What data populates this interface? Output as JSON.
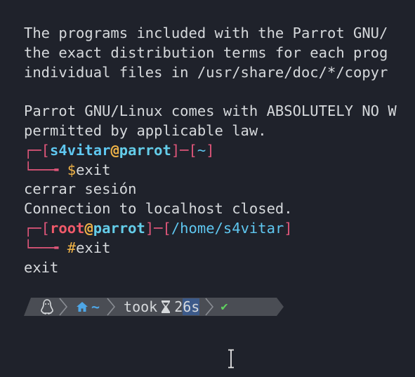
{
  "terminal": {
    "lines": {
      "l1": "The programs included with the Parrot GNU/",
      "l2": "the exact distribution terms for each prog",
      "l3": "individual files in /usr/share/doc/*/copyr",
      "l5": "Parrot GNU/Linux comes with ABSOLUTELY NO W",
      "l6": "permitted by applicable law.",
      "logout_msg": "cerrar sesión",
      "conn_closed": "Connection to localhost closed.",
      "exit_out": "exit"
    },
    "prompt1": {
      "user": "s4vitar",
      "at": "@",
      "host": "parrot",
      "path": "~",
      "symbol": "$",
      "command": "exit"
    },
    "prompt2": {
      "user": "root",
      "at": "@",
      "host": "parrot",
      "path": "/home/s4vitar",
      "symbol": "#",
      "command": "exit"
    },
    "statusbar": {
      "os_icon": "tux-icon",
      "dir_icon": "home-icon",
      "dir": "~",
      "took_label": "took",
      "timer_icon": "hourglass-icon",
      "duration_a": "2",
      "duration_b": "6s",
      "status_icon": "✔"
    },
    "colors": {
      "background": "#1f222b",
      "text": "#d6d9dc",
      "prompt_box": "#e0567a",
      "user_blue": "#5fc7f0",
      "user_red": "#f05a6a",
      "at_yellow": "#f0b347",
      "host_cyan": "#64cde9",
      "bar_bg": "#4a4d54",
      "bar_arrow": "#62656c",
      "check_green": "#5fd35f"
    }
  }
}
